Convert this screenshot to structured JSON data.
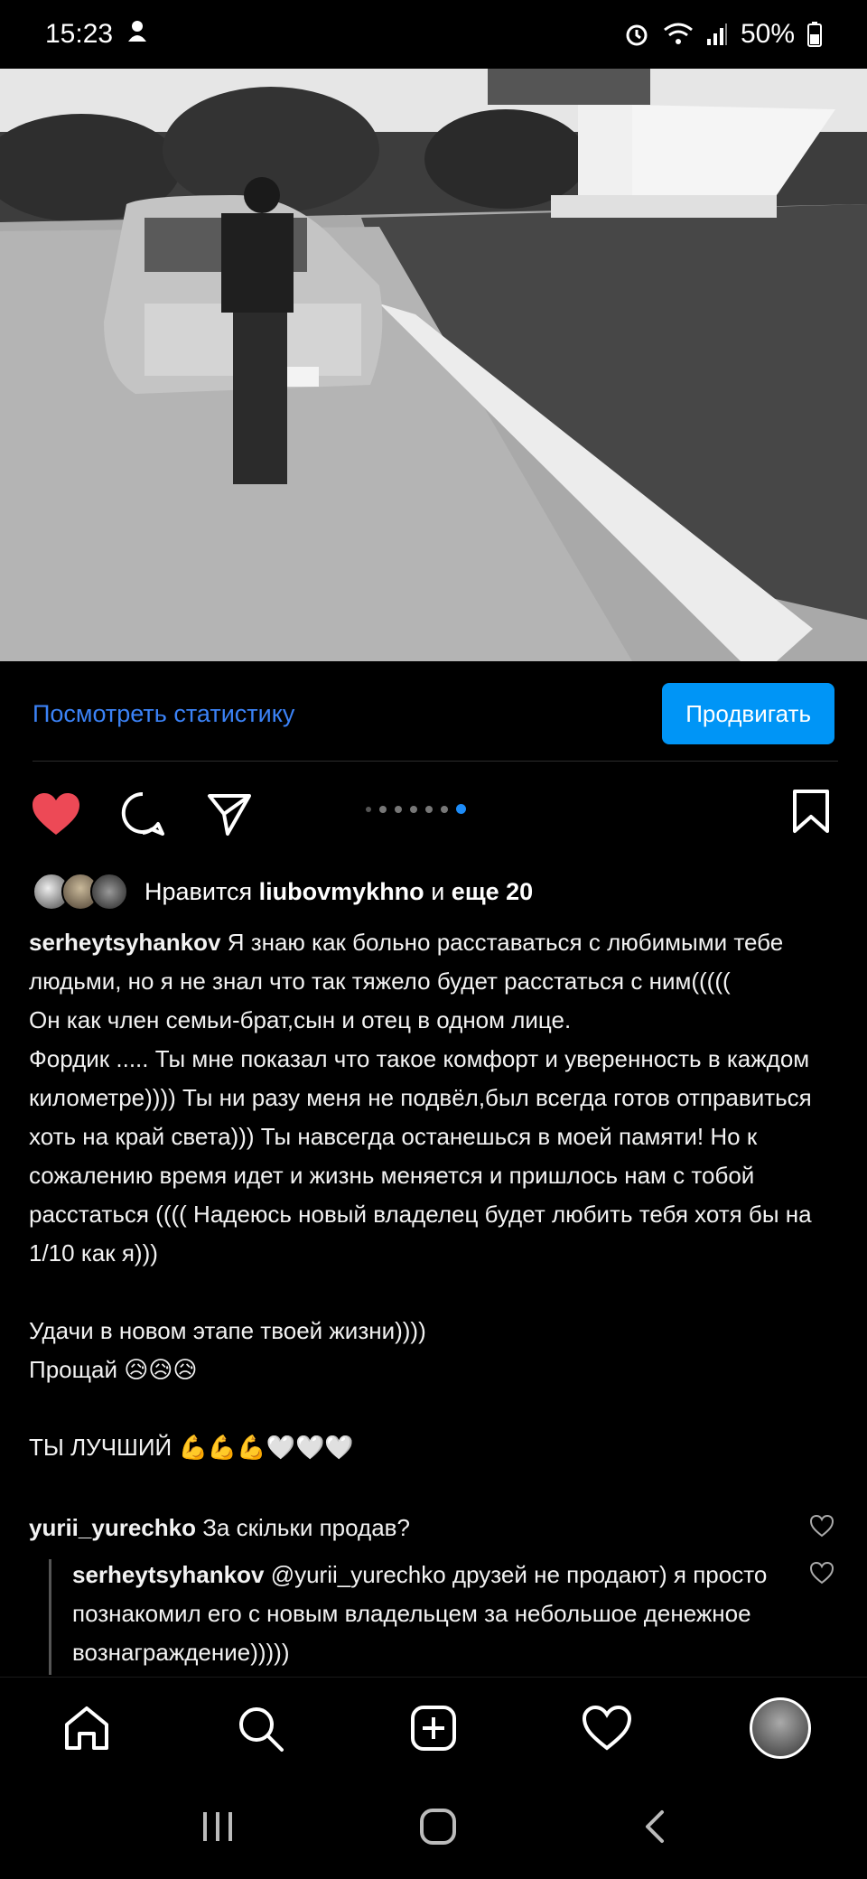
{
  "status_bar": {
    "time": "15:23",
    "battery": "50%"
  },
  "post": {
    "stats_link": "Посмотреть статистику",
    "promote_button": "Продвигать",
    "carousel": {
      "count": 7,
      "active_index": 6
    },
    "likes": {
      "prefix": "Нравится",
      "user": "liubovmykhno",
      "connector": "и",
      "others": "еще 20"
    },
    "caption": {
      "author": "serheytsyhankov",
      "text": "Я знаю как больно расставаться с любимыми тебе людьми, но я не знал что так тяжело будет расстаться с ним(((((\nОн как член семьи-брат,сын и отец в одном лице.\nФордик ..... Ты мне показал что такое комфорт и уверенность в каждом километре)))) Ты ни разу меня не подвёл,был всегда готов отправиться хоть на край света))) Ты навсегда останешься в моей памяти! Но к сожалению время идет и жизнь меняется и пришлось нам с тобой расстаться (((( Надеюсь новый владелец будет любить тебя хотя бы на 1/10 как я)))\n\nУдачи в новом этапе твоей жизни))))\nПрощай 😥😥😥\n\nТЫ ЛУЧШИЙ 💪💪💪🤍🤍🤍"
    },
    "comments": [
      {
        "author": "yurii_yurechko",
        "text": "За скільки продав?"
      },
      {
        "author": "serheytsyhankov",
        "text": "@yurii_yurechko друзей не продают) я просто познакомил его с новым владельцем за небольшое денежное вознаграждение)))))"
      }
    ]
  },
  "icons": {
    "like": "heart-filled-icon",
    "comment": "comment-icon",
    "share": "send-icon",
    "save": "bookmark-icon"
  },
  "bottom_nav": [
    "home",
    "search",
    "create",
    "activity",
    "profile"
  ],
  "colors": {
    "accent": "#0095f6",
    "like": "#ed4956",
    "link": "#3b82f6"
  }
}
